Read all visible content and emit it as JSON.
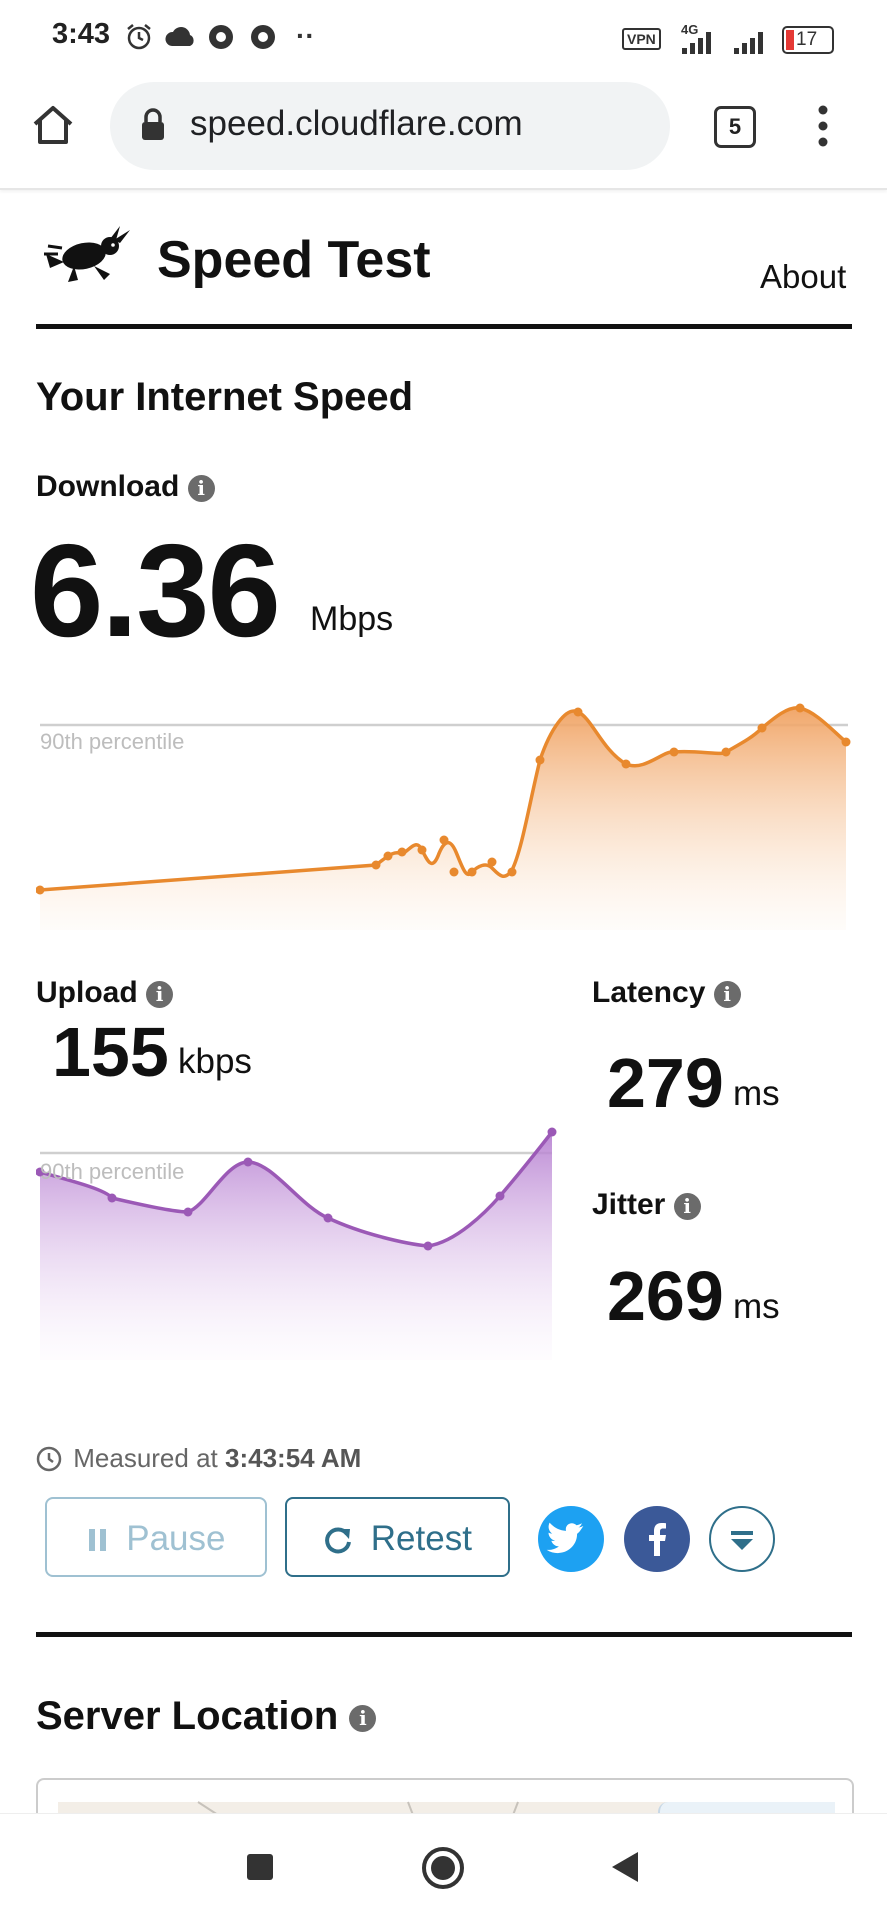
{
  "status_bar": {
    "time": "3:43",
    "vpn": "VPN",
    "network": "4G",
    "battery": "17"
  },
  "browser": {
    "url": "speed.cloudflare.com",
    "tab_count": "5"
  },
  "header": {
    "title": "Speed Test",
    "about": "About"
  },
  "section_title": "Your Internet Speed",
  "download": {
    "label": "Download",
    "value": "6.36",
    "unit": "Mbps",
    "percentile_label": "90th percentile"
  },
  "upload": {
    "label": "Upload",
    "value": "155",
    "unit": "kbps",
    "percentile_label": "90th percentile"
  },
  "latency": {
    "label": "Latency",
    "value": "279",
    "unit": "ms"
  },
  "jitter": {
    "label": "Jitter",
    "value": "269",
    "unit": "ms"
  },
  "measured": {
    "prefix": "Measured at",
    "time": "3:43:54 AM"
  },
  "buttons": {
    "pause": "Pause",
    "retest": "Retest"
  },
  "server_location": {
    "title": "Server Location"
  },
  "colors": {
    "download_line": "#e8892e",
    "upload_line": "#9b59b6",
    "accent": "#2f6f8a",
    "twitter": "#1da1f2",
    "facebook": "#3b5998"
  },
  "icons": {
    "home": "home-icon",
    "lock": "lock-icon",
    "menu": "more-vert-icon",
    "logo": "rabbit-logo-icon",
    "info": "info-icon",
    "clock": "clock-icon",
    "pause": "pause-icon",
    "retest": "refresh-icon",
    "twitter": "twitter-icon",
    "facebook": "facebook-icon",
    "download": "download-icon"
  }
}
